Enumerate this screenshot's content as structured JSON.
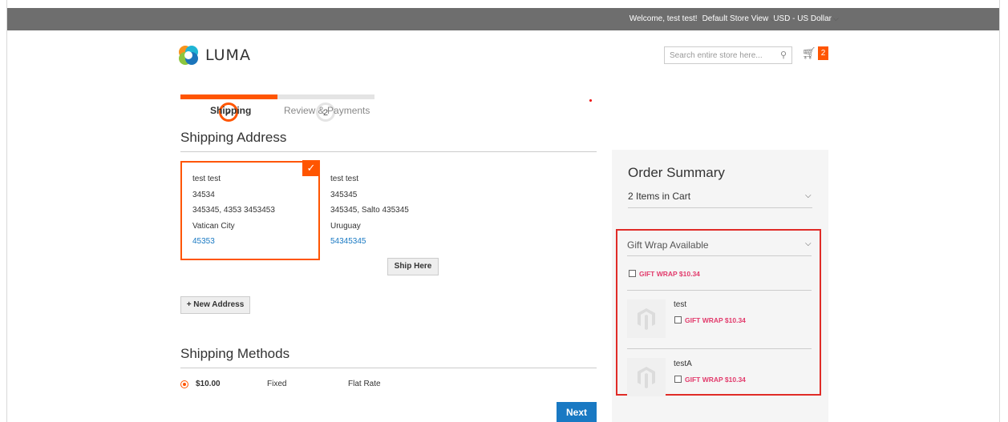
{
  "header": {
    "welcome": "Welcome, test test!",
    "store_view": "Default Store View",
    "currency": "USD - US Dollar"
  },
  "logo": {
    "text": "LUMA"
  },
  "search": {
    "placeholder": "Search entire store here..."
  },
  "cart": {
    "count": "2"
  },
  "progress": {
    "steps": [
      {
        "number": "✓",
        "label": "Shipping",
        "state": "complete"
      },
      {
        "number": "2",
        "label": "Review & Payments",
        "state": "pending"
      }
    ]
  },
  "shipping_address": {
    "title": "Shipping Address",
    "addresses": [
      {
        "name": "test test",
        "line1": "34534",
        "line2": "345345, 4353 3453453",
        "country": "Vatican City",
        "phone": "45353",
        "selected": true
      },
      {
        "name": "test test",
        "line1": "345345",
        "line2": "345345, Salto 435345",
        "country": "Uruguay",
        "phone": "54345345",
        "selected": false
      }
    ],
    "ship_here_label": "Ship Here",
    "new_address_label": "+ New Address"
  },
  "shipping_methods": {
    "title": "Shipping Methods",
    "rows": [
      {
        "price": "$10.00",
        "method": "Fixed",
        "carrier": "Flat Rate",
        "selected": true
      }
    ]
  },
  "next_label": "Next",
  "order_summary": {
    "title": "Order Summary",
    "items_in_cart": "2 Items in Cart",
    "gift_wrap": {
      "title": "Gift Wrap Available",
      "order_option": "GIFT WRAP $10.34",
      "items": [
        {
          "name": "test",
          "option": "GIFT WRAP $10.34"
        },
        {
          "name": "testA",
          "option": "GIFT WRAP $10.34"
        }
      ]
    }
  },
  "colors": {
    "accent": "#ff5501",
    "link": "#1979c3",
    "gift_wrap_text": "#e23b6c",
    "highlight_border": "#e02b27",
    "topbar": "#6e6e6e"
  }
}
